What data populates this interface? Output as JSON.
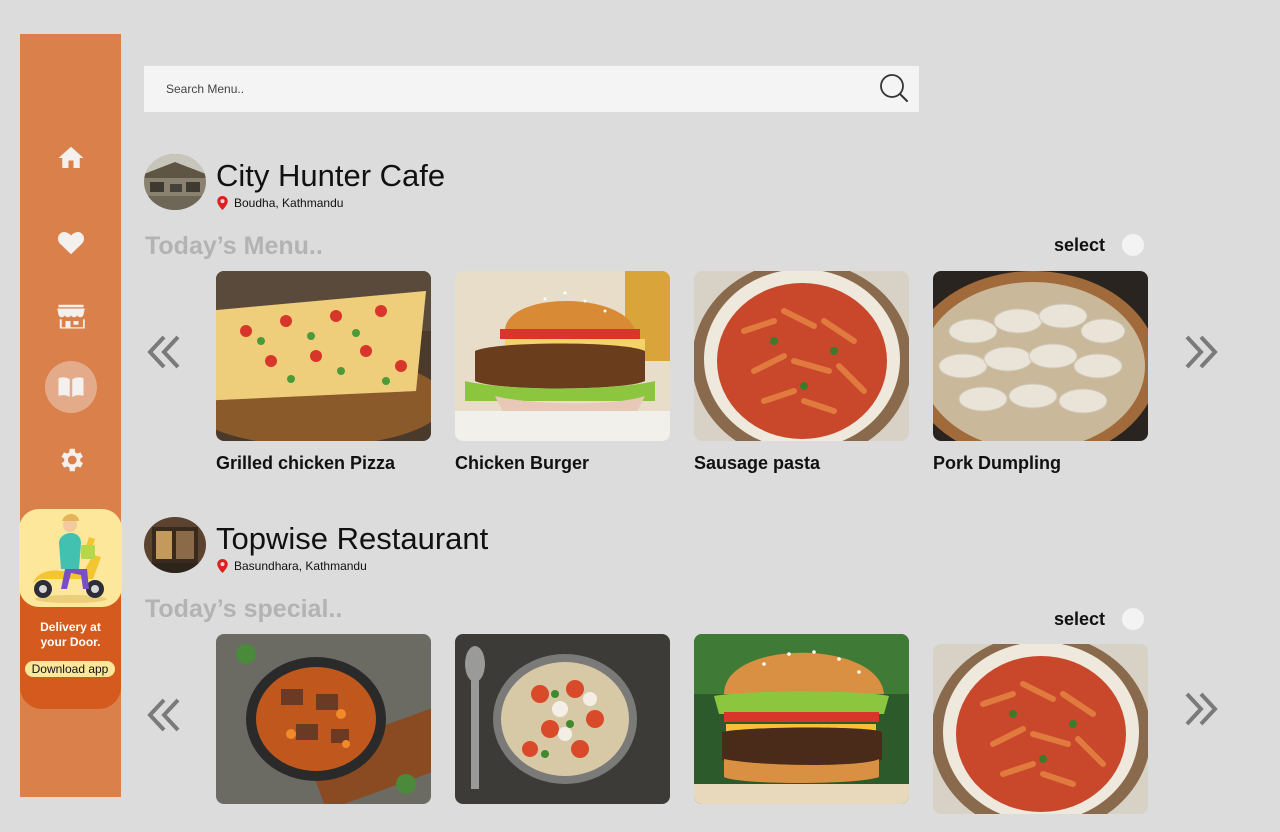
{
  "search": {
    "placeholder": "Search Menu.."
  },
  "nav": [
    {
      "name": "home-icon",
      "active": false
    },
    {
      "name": "heart-icon",
      "active": false
    },
    {
      "name": "store-icon",
      "active": false
    },
    {
      "name": "menu-book-icon",
      "active": true
    },
    {
      "name": "gear-icon",
      "active": false
    }
  ],
  "promo": {
    "line1": "Delivery at",
    "line2": "your Door.",
    "button": "Download app"
  },
  "restaurants": [
    {
      "name": "City Hunter Cafe",
      "location": "Boudha, Kathmandu",
      "section": "Today’s Menu..",
      "select_label": "select",
      "items": [
        {
          "label": "Grilled chicken Pizza",
          "image": "pizza"
        },
        {
          "label": "Chicken Burger",
          "image": "burger"
        },
        {
          "label": "Sausage pasta",
          "image": "pasta"
        },
        {
          "label": "Pork Dumpling",
          "image": "dumpling"
        }
      ]
    },
    {
      "name": "Topwise Restaurant",
      "location": "Basundhara, Kathmandu",
      "section": "Today’s special..",
      "select_label": "select",
      "items": [
        {
          "label": "",
          "image": "stew"
        },
        {
          "label": "",
          "image": "gnocchi"
        },
        {
          "label": "",
          "image": "beef-burger"
        },
        {
          "label": "",
          "image": "pasta"
        }
      ]
    }
  ],
  "colors": {
    "sidebar": "#d9804b",
    "promo": "#d55a1d",
    "promo_accent": "#fde79a",
    "section_title": "#b3b3b3",
    "pin": "#e02020"
  }
}
